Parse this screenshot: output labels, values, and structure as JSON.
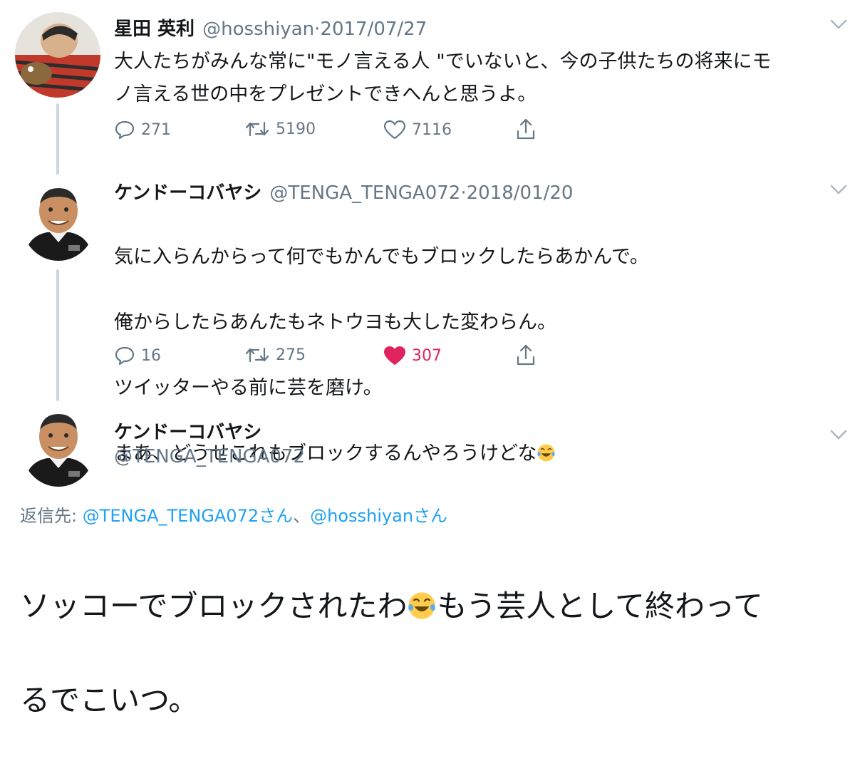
{
  "tweet1": {
    "name": "星田 英利",
    "handle": "@hosshiyan",
    "separator": "·",
    "date": "2017/07/27",
    "text": "大人たちがみんな常に\"モノ言える人 \"でいないと、今の子供たちの将来にモ\nノ言える世の中をプレゼントできへんと思うよ。",
    "replies": "271",
    "retweets": "5190",
    "likes": "7116"
  },
  "tweet2": {
    "name": "ケンドーコバヤシ",
    "handle": "@TENGA_TENGA072",
    "separator": "·",
    "date": "2018/01/20",
    "line1": "気に入らんからって何でもかんでもブロックしたらあかんで。",
    "line2": "俺からしたらあんたもネトウヨも大した変わらん。",
    "line3": "ツイッターやる前に芸を磨け。",
    "line4": "まあ、どうせこれもブロックするんやろうけどな",
    "replies": "16",
    "retweets": "275",
    "likes": "307"
  },
  "tweet3": {
    "name": "ケンドーコバヤシ",
    "handle": "@TENGA_TENGA072",
    "reply_prefix": "返信先: ",
    "mention1": "@TENGA_TENGA072さん",
    "reply_sep": "、",
    "mention2": "@hosshiyanさん",
    "text_part1": "ソッコーでブロックされたわ",
    "text_part2": "もう芸人として終わって",
    "text_part3": "るでこいつ。"
  },
  "icons": [
    "reply-icon",
    "retweet-icon",
    "like-icon",
    "share-icon",
    "chevron-down-icon",
    "tears-of-joy-emoji"
  ],
  "colors": {
    "accent": "#1da1f2",
    "like": "#e0245e",
    "muted": "#657786",
    "thread": "#ccd6dd"
  }
}
